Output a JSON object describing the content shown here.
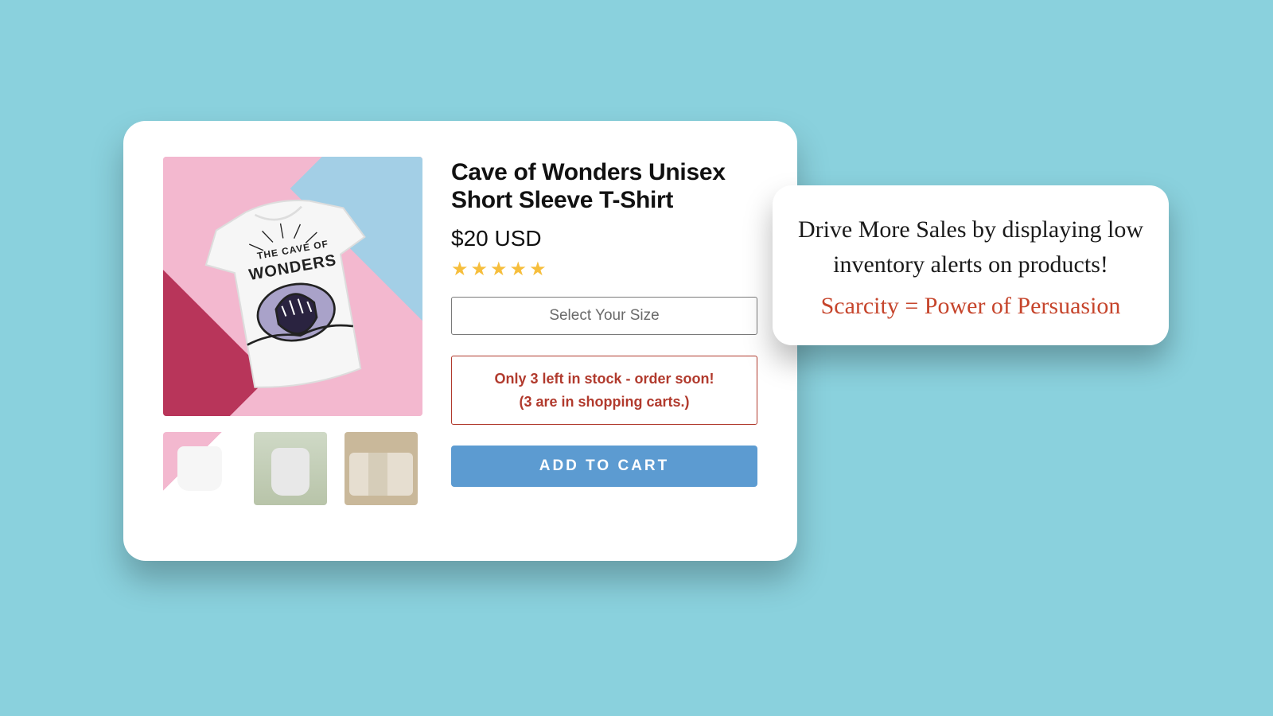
{
  "product": {
    "title": "Cave of Wonders Unisex Short Sleeve T-Shirt",
    "price": "$20 USD",
    "rating_stars": "★★★★★",
    "graphic_text_1": "THE CAVE OF",
    "graphic_text_2": "WONDERS",
    "size_select_label": "Select Your Size",
    "stock_alert_line1": "Only 3 left in stock - order soon!",
    "stock_alert_line2": "(3 are in shopping carts.)",
    "add_to_cart_label": "ADD TO CART"
  },
  "callout": {
    "line1": "Drive More Sales by displaying low inventory alerts on products!",
    "line2": "Scarcity = Power of Persuasion"
  }
}
